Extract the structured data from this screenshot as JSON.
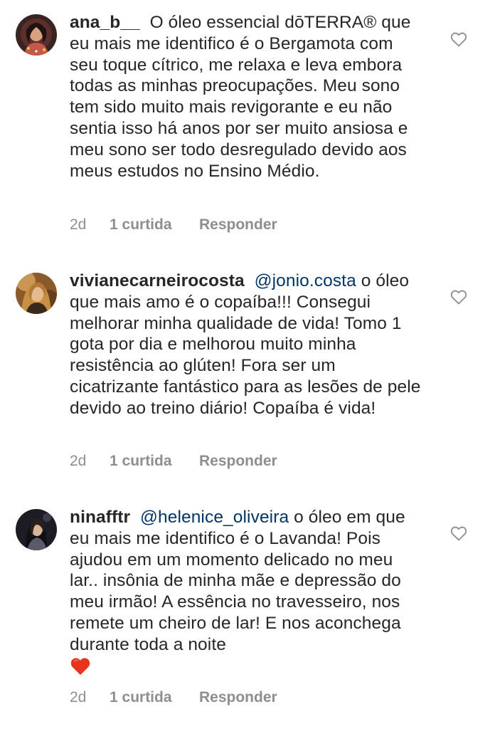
{
  "comments": [
    {
      "username": "ana_b__",
      "mention": "",
      "text": "O óleo essencial dōTERRA® que eu mais me identifico é o Bergamota com seu toque cítrico, me relaxa e leva embora todas as minhas preocupações. Meu sono tem sido muito mais revigorante e eu não sentia isso há anos por ser muito ansiosa e meu sono ser todo desregulado devido aos meus estudos no Ensino Médio.",
      "time": "2d",
      "likes": "1 curtida",
      "reply": "Responder",
      "avatar_color": "#7a4b3a"
    },
    {
      "username": "vivianecarneirocosta",
      "mention": "@jonio.costa",
      "text": "o óleo que mais amo é o copaíba!!! Consegui melhorar minha qualidade de vida! Tomo 1 gota por dia e melhorou muito minha resistência ao glúten! Fora ser um cicatrizante fantástico para as lesões de pele devido ao treino diário! Copaíba é vida!",
      "time": "2d",
      "likes": "1 curtida",
      "reply": "Responder",
      "avatar_color": "#b07a3e"
    },
    {
      "username": "ninafftr",
      "mention": "@helenice_oliveira",
      "text": "o óleo em que eu mais me identifico é o Lavanda! Pois ajudou em um momento delicado no meu lar.. insônia de minha mãe e depressão do meu irmão! A essência no travesseiro, nos remete um cheiro de lar! E nos aconchega durante toda a noite",
      "emoji": "red-heart",
      "time": "2d",
      "likes": "1 curtida",
      "reply": "Responder",
      "avatar_color": "#2a2a33"
    }
  ],
  "colors": {
    "text": "#262626",
    "meta": "#8e8e8e",
    "mention": "#003569",
    "emoji_heart": "#e8341c"
  }
}
